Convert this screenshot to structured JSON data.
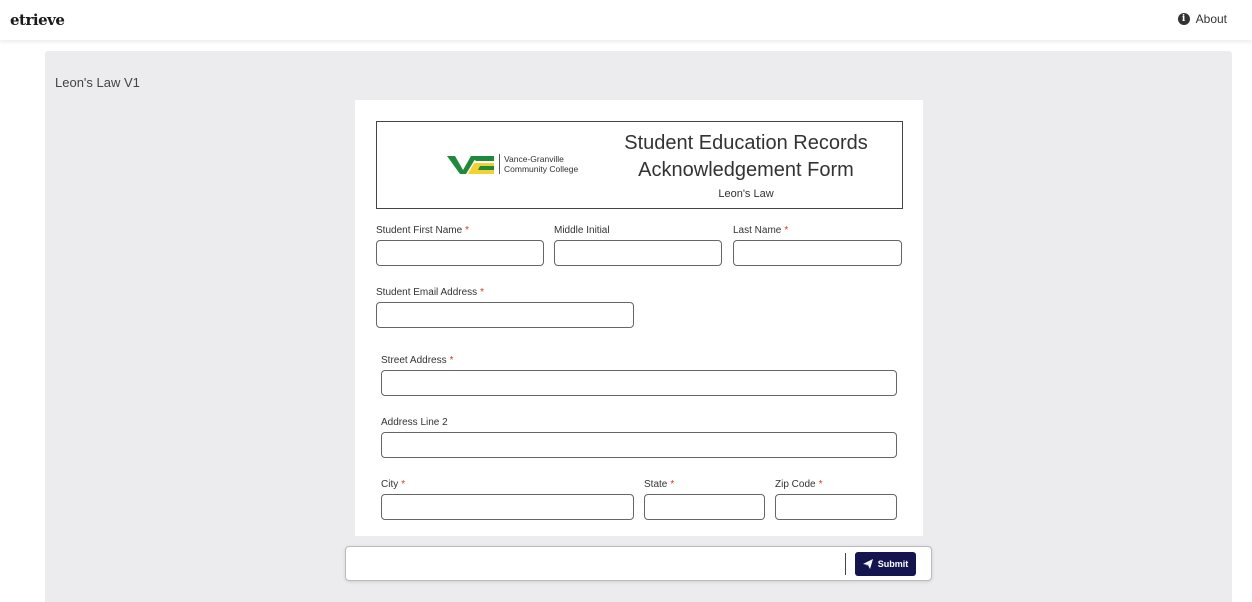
{
  "app": {
    "logo": "etrieve",
    "about_label": "About"
  },
  "panel": {
    "title": "Leon's Law V1"
  },
  "form": {
    "college_name_line1": "Vance-Granville",
    "college_name_line2": "Community College",
    "title_line1": "Student Education Records",
    "title_line2": "Acknowledgement Form",
    "subtitle": "Leon's Law",
    "required_marker": "*",
    "fields": {
      "first_name": {
        "label": "Student First Name",
        "value": "",
        "required": true
      },
      "middle_initial": {
        "label": "Middle Initial",
        "value": "",
        "required": false
      },
      "last_name": {
        "label": "Last Name",
        "value": "",
        "required": true
      },
      "email": {
        "label": "Student Email Address",
        "value": "",
        "required": true
      },
      "street": {
        "label": "Street Address",
        "value": "",
        "required": true
      },
      "address2": {
        "label": "Address Line 2",
        "value": "",
        "required": false
      },
      "city": {
        "label": "City",
        "value": "",
        "required": true
      },
      "state": {
        "label": "State",
        "value": "",
        "required": true
      },
      "zip": {
        "label": "Zip Code",
        "value": "",
        "required": true
      }
    }
  },
  "actions": {
    "submit_label": "Submit"
  },
  "colors": {
    "brand_green": "#1f8a3a",
    "brand_yellow": "#f2d22e",
    "submit_bg": "#14154f",
    "required": "#d9342b"
  },
  "icons": {
    "about": "info-circle-icon",
    "submit": "paper-plane-icon"
  }
}
